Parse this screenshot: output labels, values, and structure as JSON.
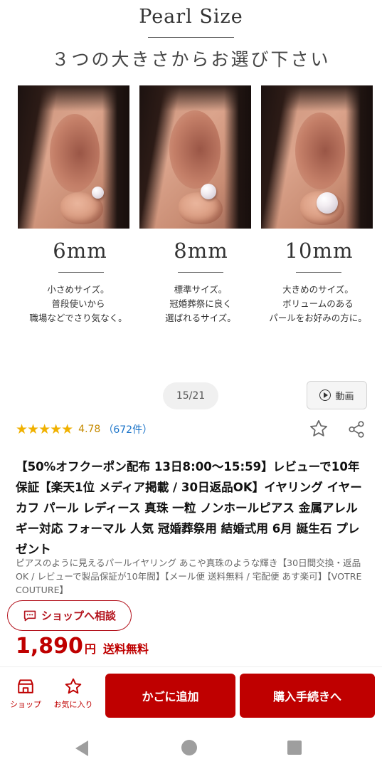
{
  "promo": {
    "title": "Pearl Size",
    "subtitle": "３つの大きさからお選び下さい",
    "sizes": [
      {
        "label": "6mm",
        "desc": [
          "小さめサイズ。",
          "普段使いから",
          "職場などでさり気なく。"
        ]
      },
      {
        "label": "8mm",
        "desc": [
          "標準サイズ。",
          "冠婚葬祭に良く",
          "選ばれるサイズ。"
        ]
      },
      {
        "label": "10mm",
        "desc": [
          "大きめのサイズ。",
          "ボリュームのある",
          "パールをお好みの方に。"
        ]
      }
    ]
  },
  "gallery": {
    "counter": "15/21",
    "video_label": "動画"
  },
  "rating": {
    "stars": "★★★★★",
    "score": "4.78",
    "count": "（672件）"
  },
  "product": {
    "title": "【50%オフクーポン配布 13日8:00～15:59】レビューで10年保証【楽天1位 メディア掲載 / 30日返品OK】イヤリング イヤーカフ パール レディース 真珠 一粒 ノンホールピアス 金属アレルギー対応 フォーマル 人気 冠婚葬祭用 結婚式用 6月 誕生石 プレゼント",
    "subtitle": "ピアスのように見えるパールイヤリング あこや真珠のような輝き【30日間交換・返品OK / レビューで製品保証が10年間】【メール便 送料無料 / 宅配便 あす楽可】【VOTRE COUTURE】",
    "consult_label": "ショップへ相談",
    "price": "1,890",
    "yen": "円",
    "shipping": "送料無料"
  },
  "actions": {
    "shop_label": "ショップ",
    "favorite_label": "お気に入り",
    "cart_label": "かごに追加",
    "buy_label": "購入手続きへ"
  },
  "colors": {
    "accent": "#bf0000",
    "star": "#f0b100",
    "link": "#1a73c8"
  }
}
